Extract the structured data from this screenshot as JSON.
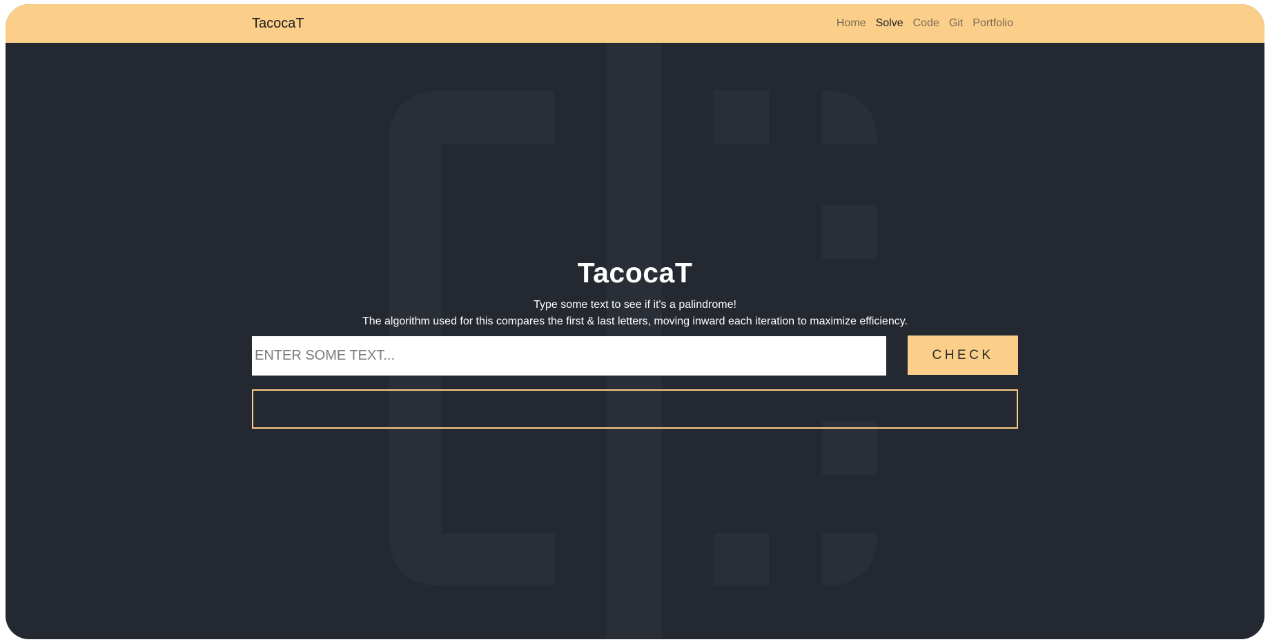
{
  "navbar": {
    "brand": "TacocaT",
    "links": [
      {
        "label": "Home",
        "active": false
      },
      {
        "label": "Solve",
        "active": true
      },
      {
        "label": "Code",
        "active": false
      },
      {
        "label": "Git",
        "active": false
      },
      {
        "label": "Portfolio",
        "active": false
      }
    ]
  },
  "hero": {
    "title": "TacocaT",
    "subtitle_line1": "Type some text to see if it's a palindrome!",
    "subtitle_line2": "The algorithm used for this compares the first & last letters, moving inward each iteration to maximize efficiency."
  },
  "form": {
    "input_value": "",
    "input_placeholder": "ENTER SOME TEXT...",
    "check_label": "CHECK"
  },
  "result": {
    "text": ""
  },
  "colors": {
    "accent": "#fbcf8a",
    "background": "#242830",
    "watermark": "#2a2f37"
  }
}
